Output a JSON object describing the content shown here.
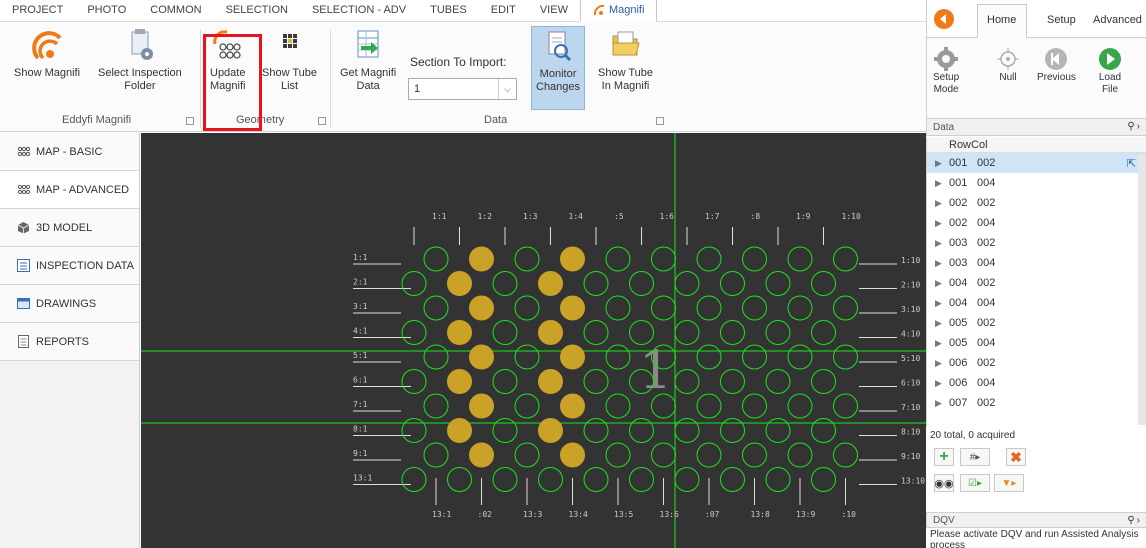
{
  "ribbon_tabs": [
    "PROJECT",
    "PHOTO",
    "COMMON",
    "SELECTION",
    "SELECTION - ADV",
    "TUBES",
    "EDIT",
    "VIEW",
    "Magnifi"
  ],
  "ribbon": {
    "show_magnifi": "Show Magnifi",
    "select_folder_1": "Select Inspection",
    "select_folder_2": "Folder",
    "update_1": "Update",
    "update_2": "Magnifi",
    "show_tube_list_1": "Show Tube",
    "show_tube_list_2": "List",
    "get_data_1": "Get Magnifi",
    "get_data_2": "Data",
    "section_label": "Section To Import:",
    "section_value": "1",
    "monitor_1": "Monitor",
    "monitor_2": "Changes",
    "show_tube_magnifi_1": "Show Tube",
    "show_tube_magnifi_2": "In Magnifi",
    "group_eddyfi": "Eddyfi Magnifi",
    "group_geometry": "Geometry",
    "group_data": "Data"
  },
  "nav": [
    "MAP - BASIC",
    "MAP - ADVANCED",
    "3D MODEL",
    "INSPECTION DATA",
    "DRAWINGS",
    "REPORTS"
  ],
  "right_tabs": {
    "home": "Home",
    "setup": "Setup",
    "advanced": "Advanced"
  },
  "right_buttons": {
    "setup_1": "Setup",
    "setup_2": "Mode",
    "null": "Null",
    "previous": "Previous",
    "load_1": "Load",
    "load_2": "File"
  },
  "data_panel": {
    "title": "Data",
    "col_row": "Row",
    "col_col": "Col",
    "rows": [
      [
        "001",
        "002"
      ],
      [
        "001",
        "004"
      ],
      [
        "002",
        "002"
      ],
      [
        "002",
        "004"
      ],
      [
        "003",
        "002"
      ],
      [
        "003",
        "004"
      ],
      [
        "004",
        "002"
      ],
      [
        "004",
        "004"
      ],
      [
        "005",
        "002"
      ],
      [
        "005",
        "004"
      ],
      [
        "006",
        "002"
      ],
      [
        "006",
        "004"
      ],
      [
        "007",
        "002"
      ]
    ],
    "total": "20 total, 0 acquired"
  },
  "dqv": {
    "title": "DQV",
    "message": "Please activate DQV and run Assisted Analysis process"
  },
  "map": {
    "center_label": "1",
    "top_col_labels": [
      "1:1",
      "1:2",
      "1:3",
      "1:4",
      ":5",
      "1:6",
      "1:7",
      ":8",
      "1:9",
      "1:10"
    ],
    "bottom_col_labels": [
      "13:1",
      ":02",
      "13:3",
      "13:4",
      "13:5",
      "13:6",
      ":07",
      "13:8",
      "13:9",
      ":10"
    ],
    "left_row_labels": [
      "1:1",
      "2:1",
      "3:1",
      "4:1",
      "5:1",
      "6:1",
      "7:1",
      "8:1",
      "9:1",
      "13:1"
    ],
    "right_row_labels": [
      "1:10",
      "2:10",
      "3:10",
      "4:10",
      "5:10",
      "6:10",
      "7:10",
      "8:10",
      "9:10",
      "13:10"
    ],
    "colors": {
      "background": "#333333",
      "tube_outline": "#19e619",
      "tube_fill": "#c9a227",
      "crosshair": "#19e619",
      "label": "#cccccc"
    }
  }
}
